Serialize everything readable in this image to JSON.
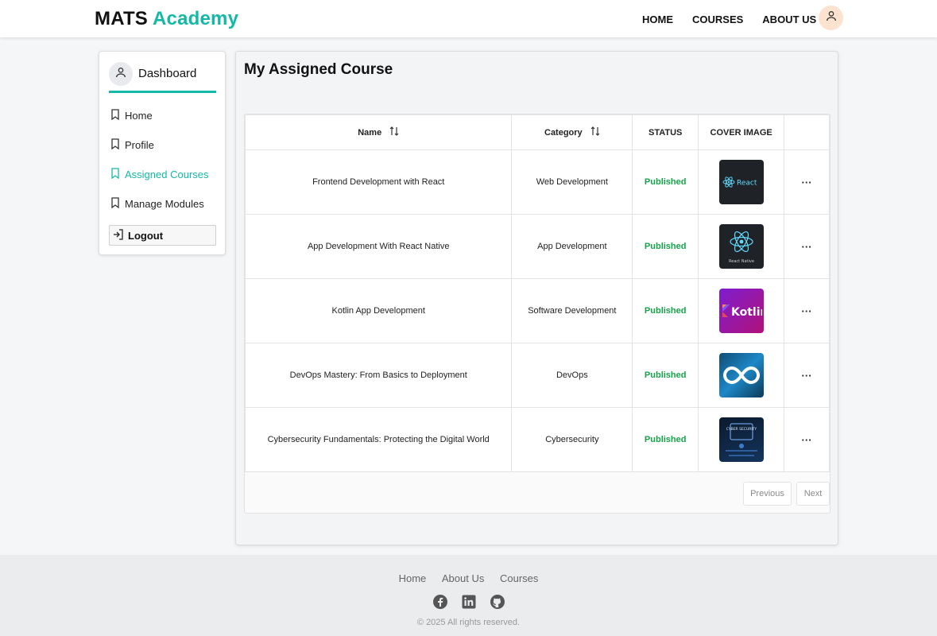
{
  "brand": {
    "part1": "MATS",
    "part2": "Academy"
  },
  "nav": {
    "links": [
      "HOME",
      "COURSES",
      "ABOUT US"
    ]
  },
  "sidebar": {
    "title": "Dashboard",
    "items": [
      {
        "label": "Home"
      },
      {
        "label": "Profile"
      },
      {
        "label": "Assigned Courses"
      },
      {
        "label": "Manage Modules"
      }
    ],
    "logout": "Logout"
  },
  "main": {
    "title": "My Assigned Course",
    "columns": [
      "Name",
      "Category",
      "STATUS",
      "COVER IMAGE",
      ""
    ],
    "rows": [
      {
        "name": "Frontend Development with React",
        "category": "Web Development",
        "status": "Published",
        "cover_text": "React",
        "action": "···"
      },
      {
        "name": "App Development With React Native",
        "category": "App Development",
        "status": "Published",
        "cover_text": "React Native",
        "action": "···"
      },
      {
        "name": "Kotlin App Development",
        "category": "Software Development",
        "status": "Published",
        "cover_text": "Kotlin",
        "action": "···"
      },
      {
        "name": "DevOps Mastery: From Basics to Deployment",
        "category": "DevOps",
        "status": "Published",
        "cover_text": "",
        "action": "···"
      },
      {
        "name": "Cybersecurity Fundamentals: Protecting the Digital World",
        "category": "Cybersecurity",
        "status": "Published",
        "cover_text": "CYBER SECURITY",
        "action": "···"
      }
    ],
    "pagination": {
      "previous": "Previous",
      "next": "Next"
    }
  },
  "footer": {
    "links": [
      "Home",
      "About Us",
      "Courses"
    ],
    "icons": [
      "facebook-icon",
      "linkedin-icon",
      "github-icon"
    ],
    "copyright": "© 2025 All rights reserved."
  },
  "colors": {
    "accent": "#14b8a6",
    "status_published": "#16a34a",
    "avatar_bg": "#fde3cf"
  }
}
